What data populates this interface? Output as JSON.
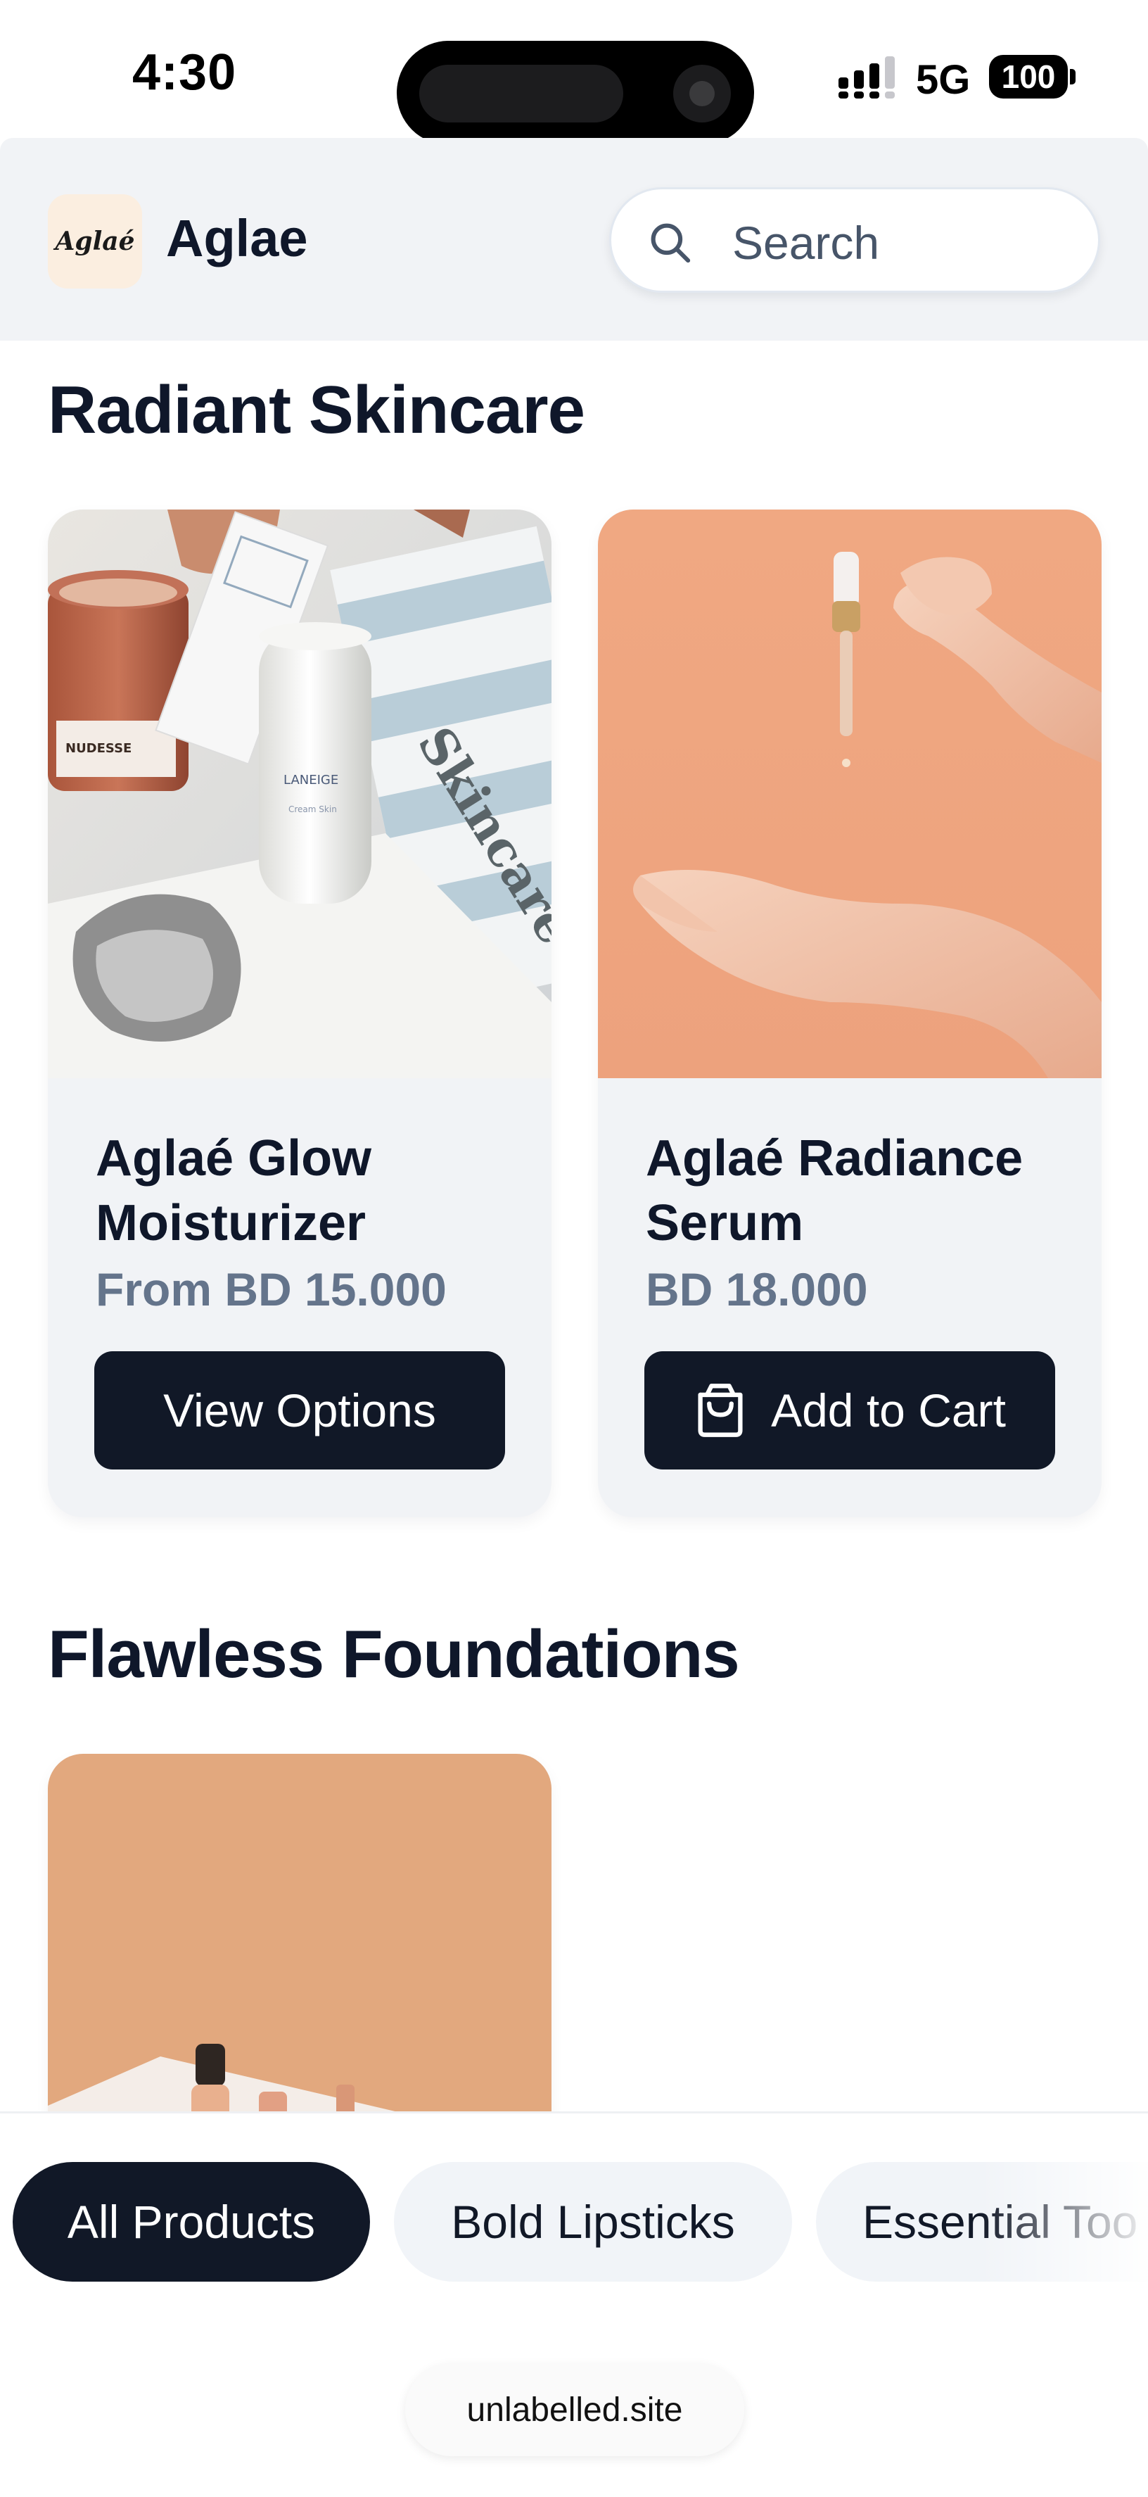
{
  "status_bar": {
    "time": "4:30",
    "network": "5G",
    "battery": "100"
  },
  "header": {
    "brand_name": "Aglae",
    "logo_text": "Aglaé",
    "search_placeholder": "Search"
  },
  "sections": [
    {
      "title": "Radiant Skincare",
      "products": [
        {
          "name": "Aglaé Glow Moisturizer",
          "price": "From BD 15.000",
          "button": "View Options",
          "button_icon": ""
        },
        {
          "name": "Aglaé Radiance Serum",
          "price": "BD 18.000",
          "button": "Add to Cart",
          "button_icon": "shopping-bag-icon"
        }
      ]
    },
    {
      "title": "Flawless Foundations",
      "products": []
    }
  ],
  "categories": [
    "All Products",
    "Bold Lipsticks",
    "Essential Too"
  ],
  "active_category": "All Products",
  "browser": {
    "url": "unlabelled.site"
  },
  "colors": {
    "primary": "#111827",
    "header_bg": "#f1f3f6",
    "price": "#64748b",
    "card_bg": "#f1f3f6"
  }
}
